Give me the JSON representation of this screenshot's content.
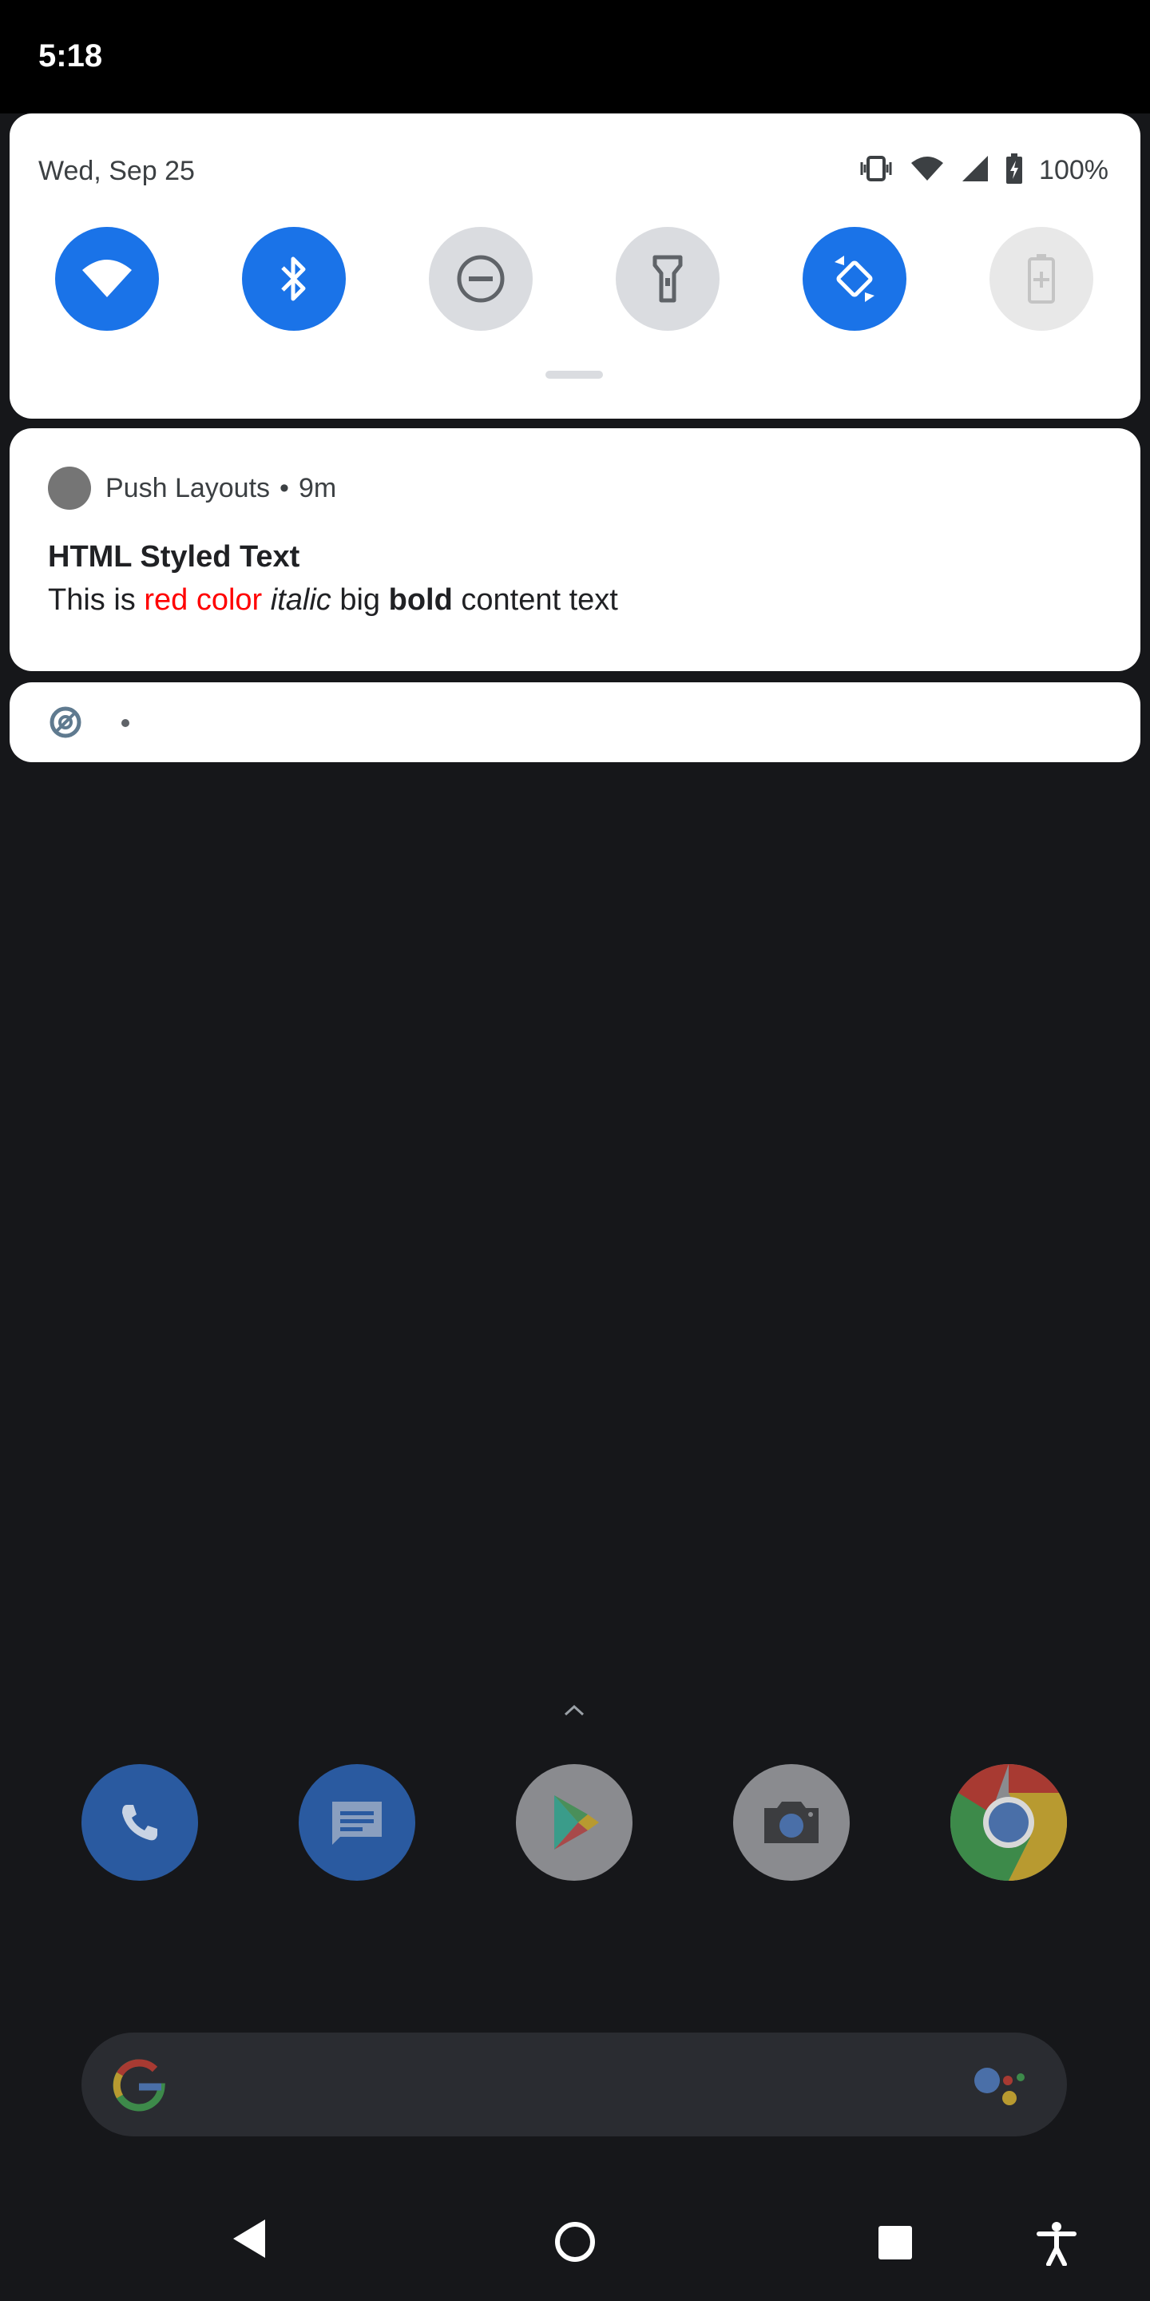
{
  "statusbar": {
    "time": "5:18"
  },
  "quick_settings": {
    "date": "Wed, Sep 25",
    "battery_percent": "100%",
    "tiles": [
      {
        "name": "wifi",
        "state": "on"
      },
      {
        "name": "bluetooth",
        "state": "on"
      },
      {
        "name": "do-not-disturb",
        "state": "off"
      },
      {
        "name": "flashlight",
        "state": "off"
      },
      {
        "name": "auto-rotate",
        "state": "on"
      },
      {
        "name": "battery-saver",
        "state": "unavailable"
      }
    ]
  },
  "notification": {
    "app_name": "Push Layouts",
    "separator": "•",
    "time_ago": "9m",
    "title": "HTML Styled Text",
    "body": {
      "part1": "This is ",
      "red": "red color",
      "part2": " ",
      "italic": "italic",
      "part3": " big ",
      "bold": "bold",
      "part4": " content text"
    },
    "colors": {
      "red_text": "#ff0000"
    }
  },
  "secondary_notification": {
    "icon": "data-saver-icon"
  },
  "dock": {
    "apps": [
      "phone",
      "messages",
      "play-store",
      "camera",
      "chrome"
    ]
  },
  "colors": {
    "accent": "#1a73e8",
    "background": "#16171a"
  }
}
